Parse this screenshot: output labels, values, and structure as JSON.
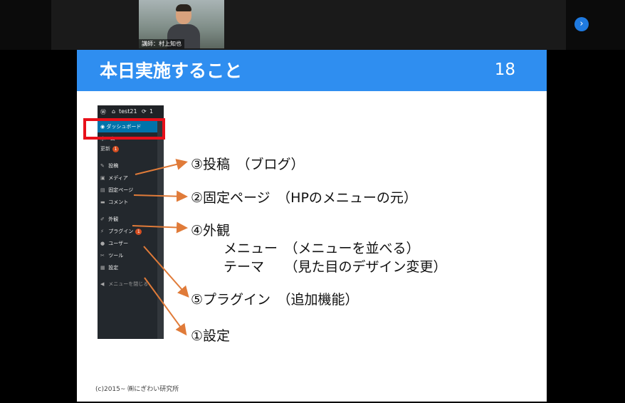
{
  "meeting": {
    "speaker_name": "講師：村上知也",
    "next_icon": "chevron-right-icon"
  },
  "slide": {
    "title": "本日実施すること",
    "page_number": "18",
    "credit": "(c)2015~ ㈱にぎわい研究所",
    "colors": {
      "header": "#2f8ef0",
      "highlight": "#e8101a",
      "arrow": "#e07b39"
    }
  },
  "wp_admin": {
    "site_name": "test21",
    "update_count": "1",
    "dashboard_label": "ダッシュボード",
    "home_label": "ホーム",
    "updates_label": "更新",
    "updates_badge": "1",
    "menu": [
      {
        "icon": "pin-icon",
        "label": "投稿"
      },
      {
        "icon": "media-icon",
        "label": "メディア"
      },
      {
        "icon": "page-icon",
        "label": "固定ページ"
      },
      {
        "icon": "comment-icon",
        "label": "コメント"
      },
      {
        "icon": "brush-icon",
        "label": "外観"
      },
      {
        "icon": "plugin-icon",
        "label": "プラグイン",
        "badge": "1"
      },
      {
        "icon": "user-icon",
        "label": "ユーザー"
      },
      {
        "icon": "wrench-icon",
        "label": "ツール"
      },
      {
        "icon": "settings-icon",
        "label": "設定"
      }
    ],
    "collapse_label": "メニューを閉じる"
  },
  "annotations": [
    {
      "text": "③投稿　（ブログ）"
    },
    {
      "text": "②固定ページ　（HPのメニューの元）"
    },
    {
      "text": "④外観"
    },
    {
      "text": "メニュー　（メニューを並べる）"
    },
    {
      "text": "テーマ　　（見た目のデザイン変更）"
    },
    {
      "text": "⑤プラグイン　（追加機能）"
    },
    {
      "text": "①設定"
    }
  ]
}
